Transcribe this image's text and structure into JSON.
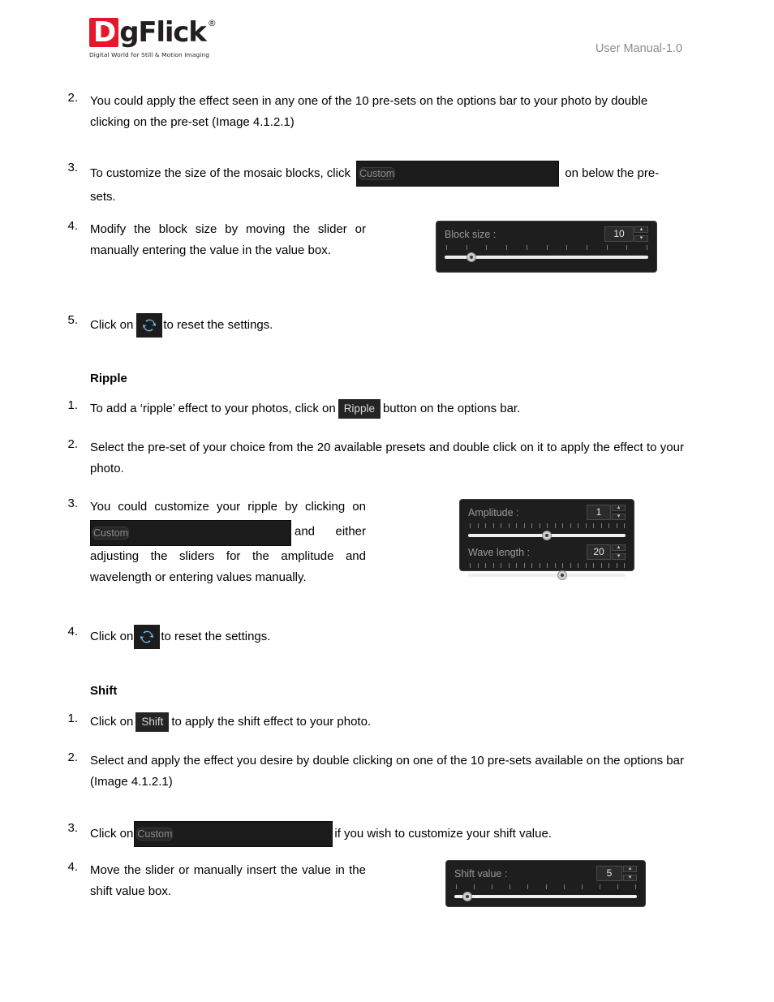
{
  "header": {
    "logo": {
      "letter_d": "D",
      "rest": "gFlick",
      "registered": "®",
      "tagline": "Digital World for Still & Motion Imaging"
    },
    "manual_version": "User Manual-1.0"
  },
  "sections": {
    "mosaic": {
      "item2": {
        "num": "2.",
        "text": "You could apply the effect seen in any one of the 10 pre-sets on the options bar to your photo by double clicking on the pre-set (Image 4.1.2.1)"
      },
      "item3": {
        "num": "3.",
        "text_before": "To customize the size of the mosaic blocks, click",
        "button_label": "Custom",
        "text_after": "on below the pre-sets."
      },
      "item4": {
        "num": "4.",
        "text": "Modify the block size by moving the slider or manually entering the value in the value box."
      },
      "item5": {
        "num": "5.",
        "text_before": "Click on",
        "icon": "reset-refresh-icon",
        "text_after": "to reset the settings."
      },
      "block_size_panel": {
        "label": "Block size :",
        "value": "10",
        "spin_up": "▴",
        "spin_down": "▾",
        "slider_percent": 13,
        "tick_count": 11
      }
    },
    "ripple": {
      "heading": "Ripple",
      "item1": {
        "num": "1.",
        "text_before": "To add a ‘ripple’ effect to your photos, click on",
        "button_label": "Ripple",
        "text_after": "button on the options bar."
      },
      "item2": {
        "num": "2.",
        "text": "Select the pre-set of your choice from the 20 available presets and double click on it to apply the effect to your photo."
      },
      "item3": {
        "num": "3.",
        "text_line1": "You could customize your ripple by clicking on",
        "button_label": "Custom",
        "text_after": "and either adjusting the sliders for the amplitude and wavelength or entering values manually."
      },
      "item4": {
        "num": "4.",
        "text_before": "Click on",
        "icon": "reset-refresh-icon",
        "text_after": "to reset the settings."
      },
      "amplitude_panel": {
        "label": "Amplitude :",
        "value": "1",
        "spin_up": "▴",
        "spin_down": "▾",
        "slider_percent": 50,
        "tick_count": 21
      },
      "wavelength_panel": {
        "label": "Wave length :",
        "value": "20",
        "spin_up": "▴",
        "spin_down": "▾",
        "slider_percent": 60,
        "tick_count": 21
      }
    },
    "shift": {
      "heading": "Shift",
      "item1": {
        "num": "1.",
        "text_before": "Click on",
        "button_label": "Shift",
        "text_after": "to apply the shift effect to your photo."
      },
      "item2": {
        "num": "2.",
        "text": "Select and apply the effect you desire by double clicking on one of the 10 pre-sets available on the options bar (Image 4.1.2.1)"
      },
      "item3": {
        "num": "3.",
        "text_before": "Click on",
        "button_label": "Custom",
        "text_after": "if you wish to customize your shift value."
      },
      "item4": {
        "num": "4.",
        "text": "Move the slider or manually insert the value in the shift value box."
      },
      "shift_value_panel": {
        "label": "Shift value :",
        "value": "5",
        "spin_up": "▴",
        "spin_down": "▾",
        "slider_percent": 7,
        "tick_count": 11
      }
    }
  },
  "colors": {
    "brand_red": "#e8162b",
    "panel_bg": "#1e1e1e",
    "panel_border": "#3d3d3d",
    "label_gray": "#9a9a9a",
    "icon_blue": "#6cb4e4",
    "header_gray": "#8c8c8c"
  }
}
